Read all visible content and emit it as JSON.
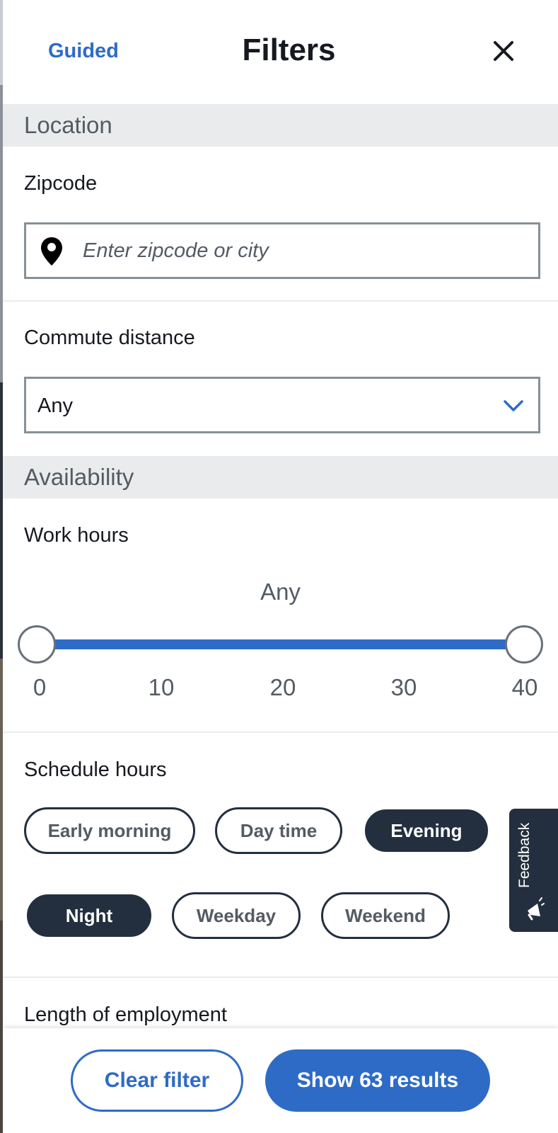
{
  "header": {
    "guided_label": "Guided",
    "title": "Filters",
    "close_icon": "close-icon"
  },
  "location": {
    "section_title": "Location",
    "zipcode_label": "Zipcode",
    "zipcode_placeholder": "Enter zipcode or city",
    "zipcode_value": "",
    "pin_icon": "map-pin-icon",
    "commute_label": "Commute distance",
    "commute_value": "Any",
    "commute_icon": "chevron-down-icon"
  },
  "availability": {
    "section_title": "Availability",
    "work_hours_label": "Work hours",
    "work_hours_value": "Any",
    "work_hours_min_selected": 0,
    "work_hours_max_selected": 40,
    "ticks": [
      "0",
      "10",
      "20",
      "30",
      "40"
    ],
    "schedule_label": "Schedule hours",
    "schedule_options": [
      {
        "label": "Early morning",
        "selected": false
      },
      {
        "label": "Day time",
        "selected": false
      },
      {
        "label": "Evening",
        "selected": true
      },
      {
        "label": "Night",
        "selected": true
      },
      {
        "label": "Weekday",
        "selected": false
      },
      {
        "label": "Weekend",
        "selected": false
      }
    ],
    "employment_label": "Length of employment"
  },
  "feedback": {
    "label": "Feedback",
    "icon": "megaphone-icon"
  },
  "footer": {
    "clear_label": "Clear filter",
    "show_label": "Show 63 results"
  },
  "colors": {
    "accent": "#2e6bc6",
    "dark": "#232f3e",
    "band": "#e9ebed",
    "muted_text": "#545b64"
  }
}
